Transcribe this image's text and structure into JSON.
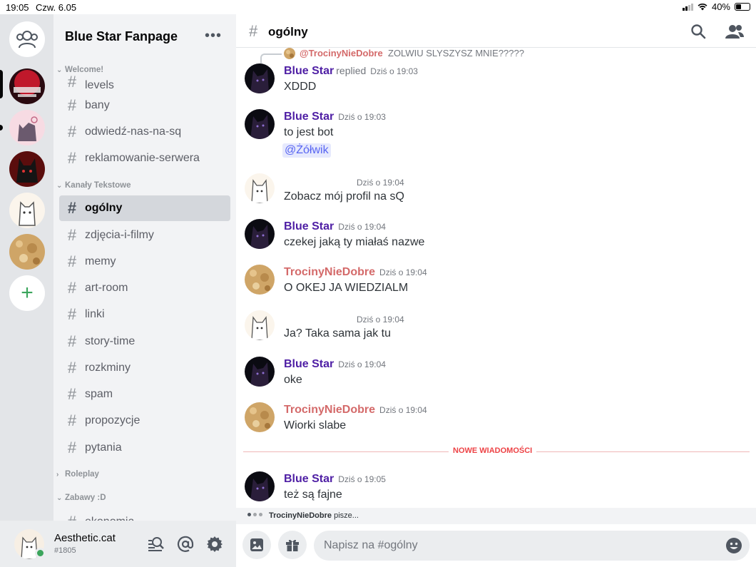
{
  "statusbar": {
    "time": "19:05",
    "date": "Czw. 6.05",
    "battery": "40%",
    "battery_level": 0.4
  },
  "guilds": {
    "home_icon": "friends-icon",
    "add_icon": "+",
    "items": [
      {
        "name": "blue-star-fanpage",
        "color": "#c0182b"
      },
      {
        "name": "wolf-cat-server",
        "color": "#f2b8c6"
      },
      {
        "name": "black-wolf-server",
        "color": "#7a1414"
      },
      {
        "name": "white-cat-server",
        "color": "#f3ebe0"
      },
      {
        "name": "sawdust-server",
        "color": "#d4b07a"
      }
    ]
  },
  "sidebar": {
    "server_name": "Blue Star Fanpage",
    "more_icon": "•••",
    "categories": {
      "welcome": "Welcome!",
      "text": "Kanały Tekstowe",
      "roleplay": "Roleplay",
      "zabawy": "Zabawy :D"
    },
    "welcome_channels": [
      "levels",
      "bany",
      "odwiedź-nas-na-sq",
      "reklamowanie-serwera"
    ],
    "text_channels": [
      "ogólny",
      "zdjęcia-i-filmy",
      "memy",
      "art-room",
      "linki",
      "story-time",
      "rozkminy",
      "spam",
      "propozycje",
      "pytania"
    ],
    "cut_channel": "ekonomia",
    "hash": "#"
  },
  "user": {
    "name": "Aesthetic.cat",
    "tag": "#1805",
    "status_color": "#3ba55c"
  },
  "header": {
    "hash": "#",
    "title": "ogólny"
  },
  "reply": {
    "name": "@TrocinyNieDobre",
    "text": "ZOLWIU SLYSZYSZ MNIE?????"
  },
  "messages": [
    {
      "author": "Blue Star",
      "replied": "replied",
      "time": "Dziś o 19:03",
      "text": "XDDD"
    },
    {
      "author": "Blue Star",
      "time": "Dziś o 19:03",
      "text": "to jest bot",
      "mention": "@Żółwik"
    },
    {
      "author": "",
      "time": "Dziś o 19:04",
      "text": "Zobacz mój profil na sQ"
    },
    {
      "author": "Blue Star",
      "time": "Dziś o 19:04",
      "text": "czekej jaką ty miałaś nazwe"
    },
    {
      "author": "TrocinyNieDobre",
      "time": "Dziś o 19:04",
      "text": "O OKEJ JA WIEDZIALM"
    },
    {
      "author": "",
      "time": "Dziś o 19:04",
      "text": "Ja? Taka sama jak tu"
    },
    {
      "author": "Blue Star",
      "time": "Dziś o 19:04",
      "text": "oke"
    },
    {
      "author": "TrocinyNieDobre",
      "time": "Dziś o 19:04",
      "text": "Wiorki slabe"
    },
    {
      "author": "Blue Star",
      "time": "Dziś o 19:05",
      "text": "też są fajne"
    }
  ],
  "new_messages_label": "NOWE WIADOMOŚCI",
  "typing": {
    "name": "TrocinyNieDobre",
    "suffix": "pisze..."
  },
  "composer": {
    "placeholder": "Napisz na #ogólny"
  },
  "colors": {
    "blue_star": "#4e1ea4",
    "troc": "#d46a6a",
    "accent": "#5865f2",
    "new": "#ed4245"
  }
}
